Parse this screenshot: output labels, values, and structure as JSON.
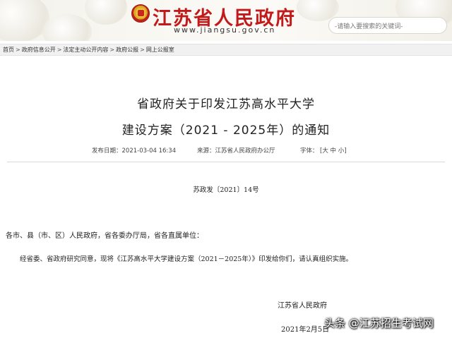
{
  "header": {
    "site_title": "江苏省人民政府",
    "site_url": "www.jiangsu.gov.cn",
    "search_placeholder": "-请输入要搜索的关键词-"
  },
  "breadcrumb": {
    "items": [
      "首页",
      "政府信息公开",
      "法定主动公开内容",
      "政府公报",
      "网上公报室"
    ],
    "separator": ">"
  },
  "document": {
    "title_line1": "省政府关于印发江苏高水平大学",
    "title_line2": "建设方案（2021 - 2025年）的通知",
    "publish_label": "发布日期：2021-03-04 16:34",
    "source_label": "来源：江苏省人民政府办公厅",
    "font_label": "字体：",
    "font_sizes": "[大 中 小]",
    "doc_number": "苏政发〔2021〕14号",
    "addressee": "各市、县（市、区）人民政府，省各委办厅局，省各直属单位：",
    "paragraph": "经省委、省政府研究同意，现将《江苏高水平大学建设方案（2021－2025年）》印发给你们，请认真组织实施。",
    "signer": "江苏省人民政府",
    "date": "2021年2月5日"
  },
  "watermark": {
    "text": "头条 @江苏招生考试网"
  },
  "colors": {
    "title_red": "#c21a1a",
    "breadcrumb_bg": "#f1f1f1"
  }
}
